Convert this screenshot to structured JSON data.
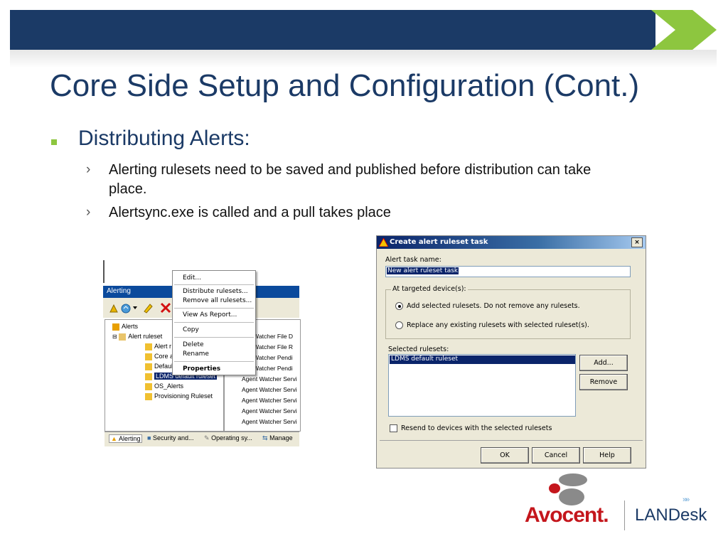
{
  "slide": {
    "title": "Core Side Setup and Configuration (Cont.)",
    "bullet1": "Distributing Alerts:",
    "sub_bullets": [
      "Alerting rulesets need to be saved and published before distribution can take",
      "place.",
      "Alertsync.exe is called and a pull takes place"
    ],
    "sub_marker": "›"
  },
  "console": {
    "panel_title": "Alerting",
    "tree": {
      "root": "Alerts",
      "ruleset_folder": "Alert ruleset",
      "items": [
        "Alert r",
        "Core a",
        "Defaul",
        "LDMS default ruleset",
        "OS_Alerts",
        "Provisioning Ruleset"
      ]
    },
    "right_rows": [
      "ent Watcher File D",
      "ent Watcher File R",
      "ent Watcher Pendi",
      "ent Watcher Pendi",
      "Agent Watcher Servi",
      "Agent Watcher Servi",
      "Agent Watcher Servi",
      "Agent Watcher Servi",
      "Agent Watcher Servi"
    ],
    "context_menu": [
      "Edit...",
      "Distribute rulesets...",
      "Remove all rulesets...",
      "View As Report...",
      "Copy",
      "Delete",
      "Rename",
      "Properties"
    ],
    "tabs": [
      "Alerting",
      "Security and...",
      "Operating sy...",
      "Manage"
    ]
  },
  "dialog": {
    "title": "Create alert ruleset task",
    "close": "×",
    "task_name_label": "Alert task name:",
    "task_name_value": "New alert ruleset task",
    "group_label": "At targeted device(s):",
    "radio_add": "Add selected rulesets.  Do not remove any rulesets.",
    "radio_replace": "Replace any existing rulesets with selected ruleset(s).",
    "selected_label": "Selected rulesets:",
    "selected_items": [
      "LDMS default ruleset"
    ],
    "add_button": "Add...",
    "remove_button": "Remove",
    "resend_label": "Resend to devices with the selected rulesets",
    "ok_button": "OK",
    "cancel_button": "Cancel",
    "help_button": "Help"
  },
  "logos": {
    "avocent": "Avocent.",
    "landesk": "LANDesk",
    "landesk_arrows": "»»"
  },
  "colors": {
    "brand_navy": "#1b3a66",
    "accent_green": "#8dc63f",
    "avocent_red": "#c4161c"
  }
}
